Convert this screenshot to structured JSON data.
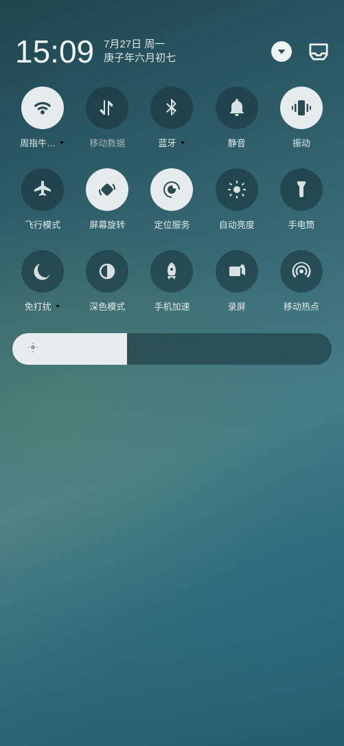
{
  "header": {
    "time": "15:09",
    "date_primary": "7月27日 周一",
    "date_secondary": "庚子年六月初七"
  },
  "tiles": [
    {
      "id": "wifi",
      "label": "周指牛…",
      "icon": "wifi",
      "active": true,
      "muted": false,
      "dropdown": true
    },
    {
      "id": "mobile-data",
      "label": "移动数据",
      "icon": "data",
      "active": false,
      "muted": true,
      "dropdown": false
    },
    {
      "id": "bluetooth",
      "label": "蓝牙",
      "icon": "bluetooth",
      "active": false,
      "muted": false,
      "dropdown": true
    },
    {
      "id": "mute",
      "label": "静音",
      "icon": "bell",
      "active": false,
      "muted": false,
      "dropdown": false
    },
    {
      "id": "vibrate",
      "label": "振动",
      "icon": "vibrate",
      "active": true,
      "muted": false,
      "dropdown": false
    },
    {
      "id": "airplane",
      "label": "飞行模式",
      "icon": "airplane",
      "active": false,
      "muted": false,
      "dropdown": false
    },
    {
      "id": "rotate",
      "label": "屏幕旋转",
      "icon": "rotate",
      "active": true,
      "muted": false,
      "dropdown": false
    },
    {
      "id": "location",
      "label": "定位服务",
      "icon": "location",
      "active": true,
      "muted": false,
      "dropdown": false
    },
    {
      "id": "auto-bright",
      "label": "自动亮度",
      "icon": "brightness",
      "active": false,
      "muted": false,
      "dropdown": false
    },
    {
      "id": "flashlight",
      "label": "手电筒",
      "icon": "flashlight",
      "active": false,
      "muted": false,
      "dropdown": false
    },
    {
      "id": "dnd",
      "label": "免打扰",
      "icon": "moon",
      "active": false,
      "muted": false,
      "dropdown": true
    },
    {
      "id": "dark-mode",
      "label": "深色模式",
      "icon": "darkmode",
      "active": false,
      "muted": false,
      "dropdown": false
    },
    {
      "id": "boost",
      "label": "手机加速",
      "icon": "rocket",
      "active": false,
      "muted": false,
      "dropdown": false
    },
    {
      "id": "screenrec",
      "label": "录屏",
      "icon": "record",
      "active": false,
      "muted": false,
      "dropdown": false
    },
    {
      "id": "hotspot",
      "label": "移动热点",
      "icon": "hotspot",
      "active": false,
      "muted": false,
      "dropdown": false
    }
  ],
  "brightness": {
    "percent": 36
  },
  "colors": {
    "tile_off_bg": "rgba(24,50,56,0.55)",
    "tile_on_bg": "#e6eced",
    "icon_on": "#2c4a52",
    "icon_off": "#d7e1e2"
  }
}
